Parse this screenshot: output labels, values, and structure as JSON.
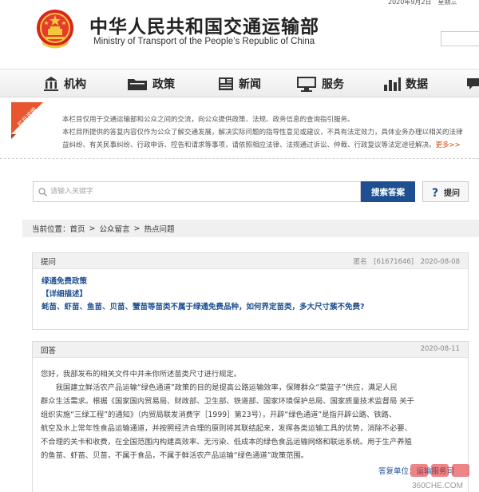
{
  "header": {
    "title_cn": "中华人民共和国交通运输部",
    "title_en": "Ministry of Transport of the People’s Republic of China",
    "date": "2020年9月2日　星期三"
  },
  "nav": [
    {
      "label": "机构",
      "icon": "building-icon"
    },
    {
      "label": "政策",
      "icon": "folder-icon"
    },
    {
      "label": "新闻",
      "icon": "newspaper-icon"
    },
    {
      "label": "服务",
      "icon": "monitor-icon"
    },
    {
      "label": "数据",
      "icon": "bar-chart-icon"
    }
  ],
  "notice": {
    "tag": "栏目说明",
    "lines": [
      "本栏目仅用于交通运输部和公众之间的交流，向公众提供政策、法规、政务信息的查询指引服务。",
      "本栏目所提供的答复内容仅作为公众了解交通发展，解决实际问题的指导性意见或建议，不具有法定效力，具体业务办理以相关的法律",
      "益纠纷、有关民事纠纷、行政申诉、控告和请求等事项，请依照相应法律、法规通过诉讼、仲裁、行政复议等法定途径解决。"
    ],
    "more": "更多>>"
  },
  "search": {
    "placeholder": "请输入关键字",
    "button": "搜索答案",
    "ask_button": "提问"
  },
  "breadcrumb": {
    "prefix": "当前位置：",
    "items": [
      "首页",
      "公众留言",
      "热点问题"
    ]
  },
  "question": {
    "header": "提问",
    "anonymous_label": "匿名",
    "id": "[61671646]",
    "date": "2020-08-08",
    "title": "绿通免费政策",
    "detail_label": "【详细描述】",
    "text": "蚝苗、虾苗、鱼苗、贝苗、蟹苗等苗类不属于绿通免费品种，如何界定苗类，多大尺寸蔟不免费?"
  },
  "answer": {
    "header": "回答",
    "date": "2020-08-11",
    "lines": [
      "您好，我部发布的相关文件中并未你所述苗类尺寸进行规定。",
      "　　我国建立鲜活农产品运输“绿色通道”政策的目的是提高公路运输效率，保障群众“菜篮子”供应，满足人民",
      "群众生活需求。根据《国家国内贸易局、财政部、卫生部、铁道部、国家环境保护总局、国家质量技术监督局 关于",
      "组织实施“三绿工程”的通知》（内贸局联发消费字［1999］第23号），开辟“绿色通道”是指开辟公路、铁路、",
      "航空及水上常年性食品运输通道，并按照经济合理的原则将其联结起来，发挥各类运输工具的优势，消除不必要、",
      "不合理的关卡和收费，在全国范围内构建高效率、无污染、低成本的绿色食品运输网络和联运系统。用于生产养殖",
      "的鱼苗、虾苗、贝苗，不属于食品，不属于鲜活农产品运输“绿色通道”政策范围。"
    ],
    "footer": "答复单位：运输服务司"
  },
  "watermark": "360CHE.COM",
  "colors": {
    "brand_blue": "#1d4f91",
    "accent_orange": "#e8552f",
    "nav_bg": "#ececec"
  }
}
